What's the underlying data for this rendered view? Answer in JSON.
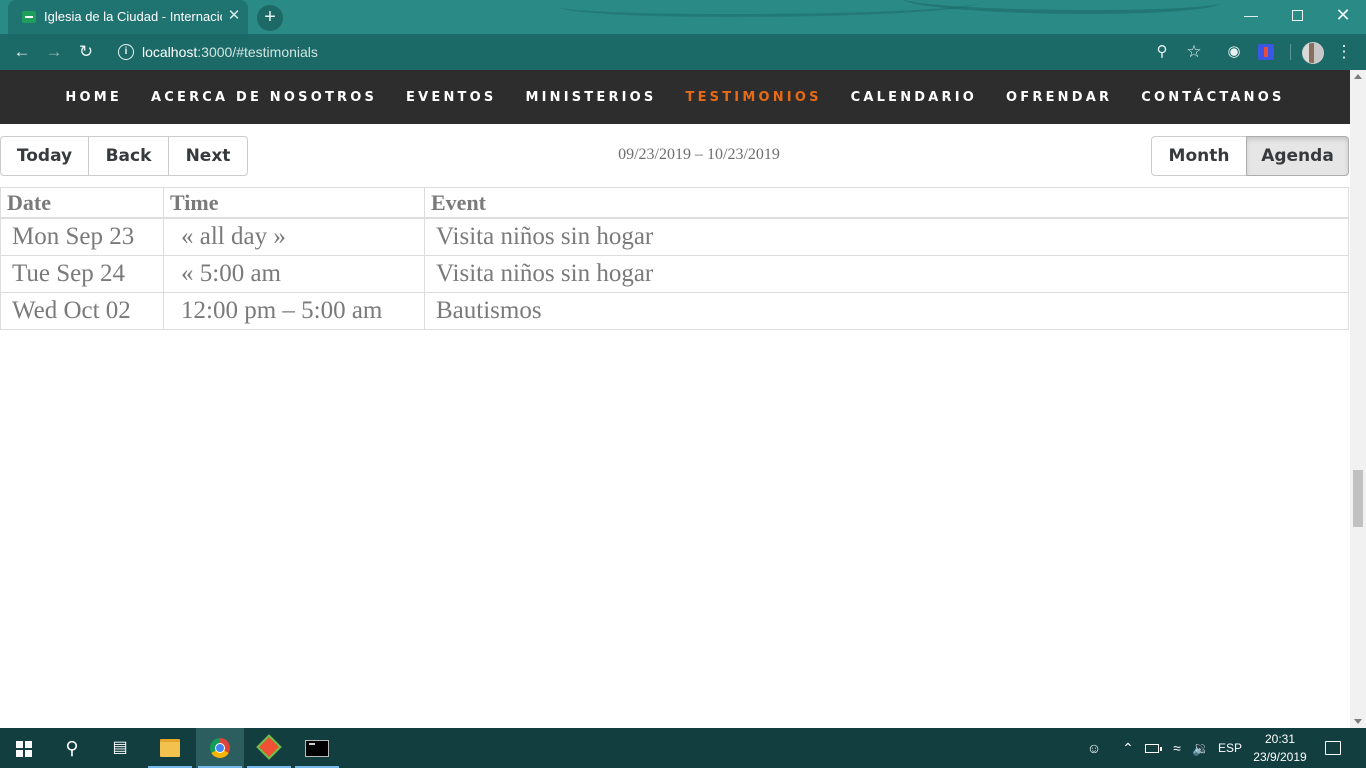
{
  "browser": {
    "tab_title": "Iglesia de la Ciudad - Internacion",
    "tab_close": "✕",
    "new_tab": "+",
    "url_host": "localhost",
    "url_path": ":3000/#testimonials"
  },
  "nav": {
    "items": [
      "HOME",
      "ACERCA DE NOSOTROS",
      "EVENTOS",
      "MINISTERIOS",
      "TESTIMONIOS",
      "CALENDARIO",
      "OFRENDAR",
      "CONTÁCTANOS"
    ],
    "active": "TESTIMONIOS",
    "active_color": "#e86a16"
  },
  "calendar": {
    "today_label": "Today",
    "back_label": "Back",
    "next_label": "Next",
    "range_label": "09/23/2019 – 10/23/2019",
    "month_label": "Month",
    "agenda_label": "Agenda",
    "active_view": "Agenda",
    "headers": {
      "date": "Date",
      "time": "Time",
      "event": "Event"
    },
    "rows": [
      {
        "date": "Mon Sep 23",
        "time": "« all day »",
        "event": "Visita niños sin hogar"
      },
      {
        "date": "Tue Sep 24",
        "time": "« 5:00 am",
        "event": "Visita niños sin hogar"
      },
      {
        "date": "Wed Oct 02",
        "time": "12:00 pm – 5:00 am",
        "event": "Bautismos"
      }
    ]
  },
  "taskbar": {
    "language": "ESP",
    "time": "20:31",
    "date": "23/9/2019",
    "pinned": [
      "windows-start",
      "search",
      "task-view",
      "file-explorer",
      "chrome",
      "git-gui",
      "command-prompt"
    ]
  },
  "colors": {
    "titlebar": "#2a8a86",
    "toolbar": "#1c6a67",
    "navbar": "#2d2d2d",
    "taskbar": "#123e40"
  }
}
